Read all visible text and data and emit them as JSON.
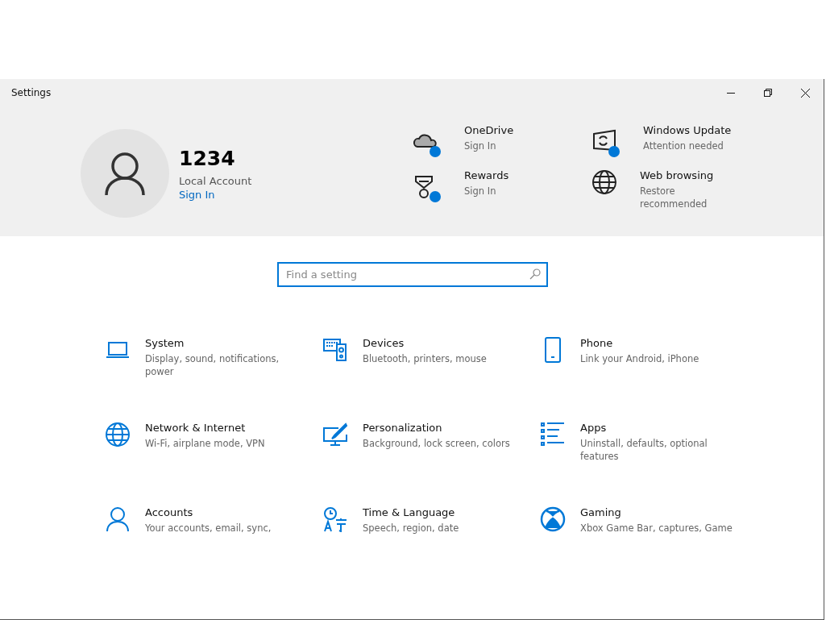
{
  "window": {
    "title": "Settings"
  },
  "account": {
    "name": "1234",
    "type": "Local Account",
    "link": "Sign In"
  },
  "quick_links": [
    {
      "kind": "cloud",
      "title": "OneDrive",
      "subtitle": "Sign In"
    },
    {
      "kind": "update",
      "title": "Windows Update",
      "subtitle": "Attention needed"
    },
    {
      "kind": "rewards",
      "title": "Rewards",
      "subtitle": "Sign In"
    },
    {
      "kind": "globe",
      "title": "Web browsing",
      "subtitle": "Restore recommended"
    }
  ],
  "search": {
    "placeholder": "Find a setting"
  },
  "categories": [
    {
      "kind": "laptop",
      "title": "System",
      "subtitle": "Display, sound, notifications, power"
    },
    {
      "kind": "keyboard",
      "title": "Devices",
      "subtitle": "Bluetooth, printers, mouse"
    },
    {
      "kind": "phone",
      "title": "Phone",
      "subtitle": "Link your Android, iPhone"
    },
    {
      "kind": "globe",
      "title": "Network & Internet",
      "subtitle": "Wi-Fi, airplane mode, VPN"
    },
    {
      "kind": "paint",
      "title": "Personalization",
      "subtitle": "Background, lock screen, colors"
    },
    {
      "kind": "list",
      "title": "Apps",
      "subtitle": "Uninstall, defaults, optional features"
    },
    {
      "kind": "person",
      "title": "Accounts",
      "subtitle": "Your accounts, email, sync,"
    },
    {
      "kind": "time",
      "title": "Time & Language",
      "subtitle": "Speech, region, date"
    },
    {
      "kind": "xbox",
      "title": "Gaming",
      "subtitle": "Xbox Game Bar, captures, Game"
    }
  ]
}
